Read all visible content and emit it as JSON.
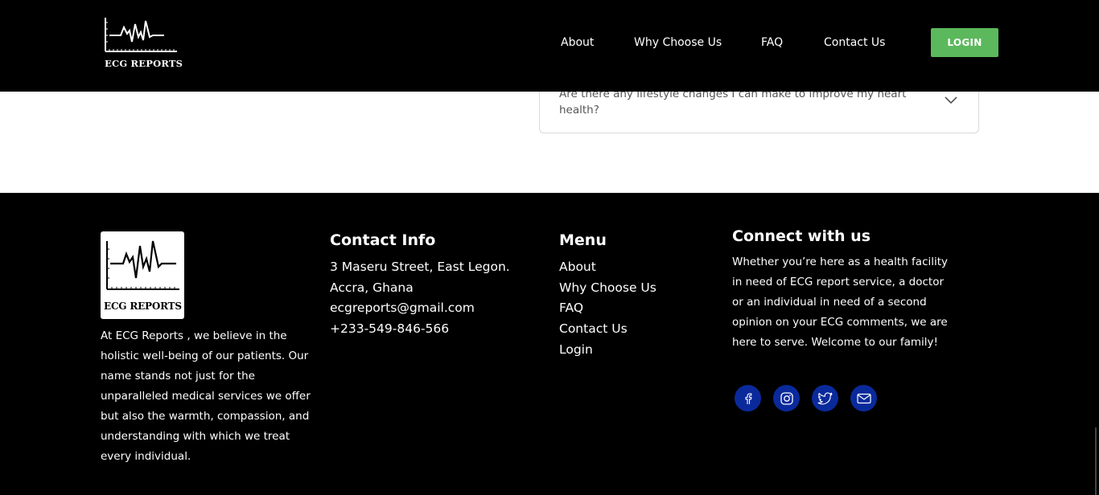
{
  "header": {
    "logo_text": "ECG REPORTS",
    "nav": [
      "About",
      "Why Choose Us",
      "FAQ",
      "Contact Us"
    ],
    "login_label": "LOGIN"
  },
  "faq": {
    "question": "Are there any lifestyle changes I can make to improve my heart health?"
  },
  "footer": {
    "logo_text": "ECG REPORTS",
    "about_text": "At ECG Reports , we believe in the holistic well-being of our patients. Our name stands not just for the unparalleled medical services we offer but also the warmth, compassion, and understanding with which we treat every individual.",
    "contact": {
      "title": "Contact Info",
      "lines": [
        "3 Maseru Street, East Legon.",
        "Accra, Ghana",
        "ecgreports@gmail.com",
        "+233-549-846-566"
      ]
    },
    "menu": {
      "title": "Menu",
      "links": [
        "About",
        "Why Choose Us",
        "FAQ",
        "Contact Us",
        "Login"
      ]
    },
    "connect": {
      "title": "Connect with us",
      "text": "Whether you’re here as a health facility in need of ECG report service, a doctor or an individual in need of a second opinion on your ECG comments, we are here to serve. Welcome to our family!",
      "socials": [
        "facebook-icon",
        "instagram-icon",
        "twitter-icon",
        "mail-icon"
      ]
    }
  },
  "colors": {
    "login_button": "#5cb85c",
    "social_circle": "#0a2a9c"
  }
}
